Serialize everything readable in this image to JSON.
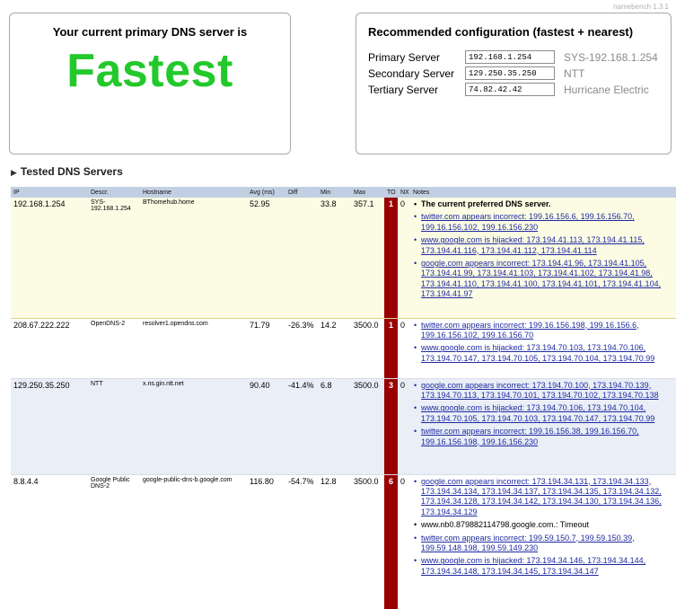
{
  "version": "namebench 1.3.1",
  "verdict": {
    "title": "Your current primary DNS server is",
    "value": "Fastest",
    "color": "#23c92a"
  },
  "recommended": {
    "title": "Recommended configuration (fastest + nearest)",
    "servers": [
      {
        "label": "Primary Server",
        "ip": "192.168.1.254",
        "name": "SYS-192.168.1.254"
      },
      {
        "label": "Secondary Server",
        "ip": "129.250.35.250",
        "name": "NTT"
      },
      {
        "label": "Tertiary Server",
        "ip": "74.82.42.42",
        "name": "Hurricane Electric"
      }
    ]
  },
  "section": {
    "title": "Tested DNS Servers",
    "icon": "triangle-right-icon"
  },
  "table": {
    "headers": [
      "IP",
      "Descr.",
      "Hostname",
      "Avg (ms)",
      "Diff",
      "Min",
      "Max",
      "TO",
      "NX",
      "Notes"
    ],
    "rows": [
      {
        "ip": "192.168.1.254",
        "descr": "SYS-192.168.1.254",
        "hostname": "BThomehub.home",
        "avg": "52.95",
        "diff": "",
        "min": "33.8",
        "max": "357.1",
        "to": "1",
        "nx": "0",
        "notes": [
          {
            "text": "The current preferred DNS server.",
            "style": "strong"
          },
          {
            "text": "twitter.com appears incorrect: 199.16.156.6, 199.16.156.70, 199.16.156.102, 199.16.156.230",
            "style": "link"
          },
          {
            "text": "www.google.com is hijacked: 173.194.41.113, 173.194.41.115, 173.194.41.116, 173.194.41.112, 173.194.41.114",
            "style": "link"
          },
          {
            "text": "google.com appears incorrect: 173.194.41.96, 173.194.41.105, 173.194.41.99, 173.194.41.103, 173.194.41.102, 173.194.41.98, 173.194.41.110, 173.194.41.100, 173.194.41.101, 173.194.41.104, 173.194.41.97",
            "style": "link"
          }
        ]
      },
      {
        "ip": "208.67.222.222",
        "descr": "OpenDNS-2",
        "hostname": "resolver1.opendns.com",
        "avg": "71.79",
        "diff": "-26.3%",
        "min": "14.2",
        "max": "3500.0",
        "to": "1",
        "nx": "0",
        "notes": [
          {
            "text": "twitter.com appears incorrect: 199.16.156.198, 199.16.156.6, 199.16.156.102, 199.16.156.70",
            "style": "link"
          },
          {
            "text": "www.google.com is hijacked: 173.194.70.103, 173.194.70.106, 173.194.70.147, 173.194.70.105, 173.194.70.104, 173.194.70.99",
            "style": "link"
          }
        ]
      },
      {
        "ip": "129.250.35.250",
        "descr": "NTT",
        "hostname": "x.ns.gin.ntt.net",
        "avg": "90.40",
        "diff": "-41.4%",
        "min": "6.8",
        "max": "3500.0",
        "to": "3",
        "nx": "0",
        "notes": [
          {
            "text": "google.com appears incorrect: 173.194.70.100, 173.194.70.139, 173.194.70.113, 173.194.70.101, 173.194.70.102, 173.194.70.138",
            "style": "link"
          },
          {
            "text": "www.google.com is hijacked: 173.194.70.106, 173.194.70.104, 173.194.70.105, 173.194.70.103, 173.194.70.147, 173.194.70.99",
            "style": "link"
          },
          {
            "text": "twitter.com appears incorrect: 199.16.156.38, 199.16.156.70, 199.16.156.198, 199.16.156.230",
            "style": "link"
          }
        ]
      },
      {
        "ip": "8.8.4.4",
        "descr": "Google Public DNS-2",
        "hostname": "google-public-dns-b.google.com",
        "avg": "116.80",
        "diff": "-54.7%",
        "min": "12.8",
        "max": "3500.0",
        "to": "6",
        "nx": "0",
        "notes": [
          {
            "text": "google.com appears incorrect: 173.194.34.131, 173.194.34.133, 173.194.34.134, 173.194.34.137, 173.194.34.135, 173.194.34.132, 173.194.34.128, 173.194.34.142, 173.194.34.130, 173.194.34.136, 173.194.34.129",
            "style": "link"
          },
          {
            "text": "www.nb0.879882114798.google.com.: Timeout",
            "style": "plain"
          },
          {
            "text": "twitter.com appears incorrect: 199.59.150.7, 199.59.150.39, 199.59.148.198, 199.59.149.230",
            "style": "link"
          },
          {
            "text": "www.google.com is hijacked: 173.194.34.146, 173.194.34.144, 173.194.34.148, 173.194.34.145, 173.194.34.147",
            "style": "link"
          }
        ]
      }
    ]
  }
}
